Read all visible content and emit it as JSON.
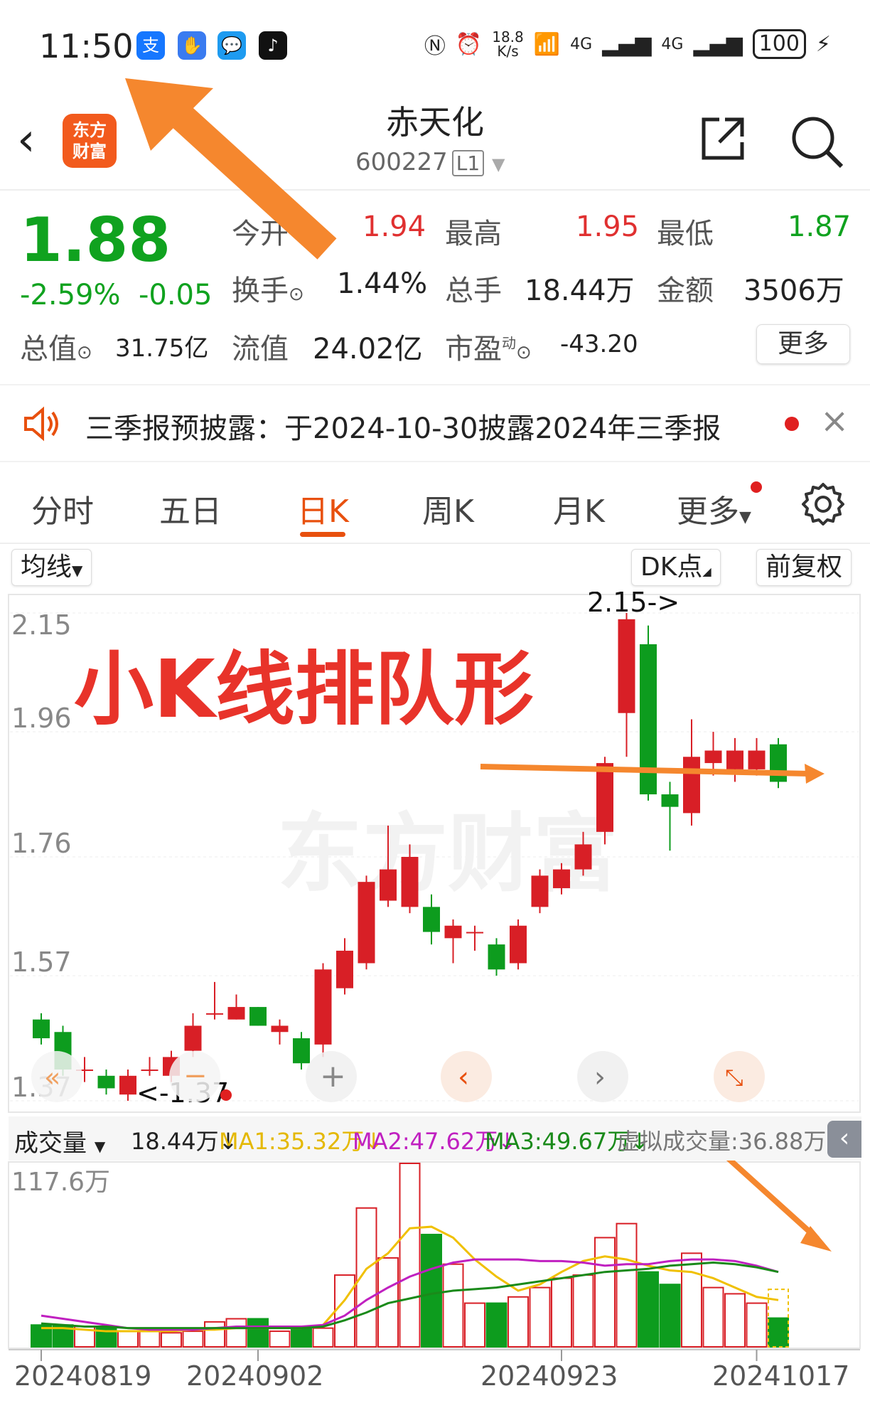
{
  "status_bar": {
    "time": "11:50",
    "net_speed_top": "18.8",
    "net_speed_bottom": "K/s",
    "signal_1": "4G",
    "signal_2": "4G",
    "battery": "100",
    "app_icon_1": "支"
  },
  "header": {
    "logo_line1": "东方",
    "logo_line2": "财富",
    "stock_name": "赤天化",
    "stock_code": "600227",
    "level_badge": "L1"
  },
  "quote": {
    "price": "1.88",
    "change_pct": "-2.59%",
    "change_abs": "-0.05",
    "today_open_label": "今开",
    "today_open": "1.94",
    "high_label": "最高",
    "high": "1.95",
    "low_label": "最低",
    "low": "1.87",
    "turnover_label": "换手",
    "turnover": "1.44%",
    "volume_label": "总手",
    "volume": "18.44万",
    "amount_label": "金额",
    "amount": "3506万",
    "total_value_label": "总值",
    "total_value": "31.75亿",
    "float_value_label": "流值",
    "float_value": "24.02亿",
    "pe_label": "市盈",
    "pe_super": "动",
    "pe": "-43.20",
    "more_label": "更多"
  },
  "notice": {
    "text": "三季报预披露：于2024-10-30披露2024年三季报"
  },
  "tabs": [
    "分时",
    "五日",
    "日K",
    "周K",
    "月K",
    "更多"
  ],
  "active_tab": "日K",
  "chart_toolbar": {
    "ma_label": "均线",
    "dk_label": "DK点",
    "adjust_label": "前复权"
  },
  "annotation": {
    "title": "小K线排队形",
    "watermark": "东方财富"
  },
  "volume_bar": {
    "label": "成交量",
    "value": "18.44万↓",
    "ma1": "MA1:35.32万↓",
    "ma2": "MA2:47.62万↓",
    "ma3": "MA3:49.67万↓",
    "virtual": "虚拟成交量:36.88万"
  },
  "colors": {
    "up": "#d81f26",
    "down": "#0d9c1e",
    "accent": "#e8500e",
    "ma1": "#f0c000",
    "ma2": "#c020c0",
    "ma3": "#1a8a1a",
    "arrow": "#f5872e"
  },
  "chart_data": {
    "type": "candlestick",
    "y_ticks": [
      "2.15",
      "1.96",
      "1.76",
      "1.57",
      "1.37"
    ],
    "ylim": [
      1.37,
      2.15
    ],
    "max_label": "2.15->",
    "min_label": "<-1.37",
    "x_labels": [
      "20240819",
      "20240902",
      "20240923",
      "20241017"
    ],
    "candles": [
      {
        "o": 1.5,
        "c": 1.47,
        "h": 1.51,
        "l": 1.46
      },
      {
        "o": 1.48,
        "c": 1.42,
        "h": 1.49,
        "l": 1.41
      },
      {
        "o": 1.42,
        "c": 1.42,
        "h": 1.44,
        "l": 1.4
      },
      {
        "o": 1.41,
        "c": 1.39,
        "h": 1.42,
        "l": 1.38
      },
      {
        "o": 1.38,
        "c": 1.41,
        "h": 1.42,
        "l": 1.37
      },
      {
        "o": 1.42,
        "c": 1.42,
        "h": 1.44,
        "l": 1.41
      },
      {
        "o": 1.41,
        "c": 1.44,
        "h": 1.45,
        "l": 1.4
      },
      {
        "o": 1.45,
        "c": 1.49,
        "h": 1.51,
        "l": 1.44
      },
      {
        "o": 1.51,
        "c": 1.51,
        "h": 1.56,
        "l": 1.5
      },
      {
        "o": 1.5,
        "c": 1.52,
        "h": 1.54,
        "l": 1.5
      },
      {
        "o": 1.52,
        "c": 1.49,
        "h": 1.52,
        "l": 1.49
      },
      {
        "o": 1.48,
        "c": 1.49,
        "h": 1.5,
        "l": 1.46
      },
      {
        "o": 1.47,
        "c": 1.43,
        "h": 1.48,
        "l": 1.42
      },
      {
        "o": 1.46,
        "c": 1.58,
        "h": 1.59,
        "l": 1.44
      },
      {
        "o": 1.55,
        "c": 1.61,
        "h": 1.63,
        "l": 1.54
      },
      {
        "o": 1.59,
        "c": 1.72,
        "h": 1.73,
        "l": 1.58
      },
      {
        "o": 1.69,
        "c": 1.74,
        "h": 1.81,
        "l": 1.68
      },
      {
        "o": 1.68,
        "c": 1.76,
        "h": 1.78,
        "l": 1.67
      },
      {
        "o": 1.68,
        "c": 1.64,
        "h": 1.7,
        "l": 1.62
      },
      {
        "o": 1.63,
        "c": 1.65,
        "h": 1.66,
        "l": 1.59
      },
      {
        "o": 1.64,
        "c": 1.64,
        "h": 1.65,
        "l": 1.61
      },
      {
        "o": 1.62,
        "c": 1.58,
        "h": 1.63,
        "l": 1.57
      },
      {
        "o": 1.59,
        "c": 1.65,
        "h": 1.66,
        "l": 1.58
      },
      {
        "o": 1.68,
        "c": 1.73,
        "h": 1.74,
        "l": 1.67
      },
      {
        "o": 1.71,
        "c": 1.74,
        "h": 1.75,
        "l": 1.7
      },
      {
        "o": 1.74,
        "c": 1.78,
        "h": 1.8,
        "l": 1.73
      },
      {
        "o": 1.8,
        "c": 1.91,
        "h": 1.92,
        "l": 1.78
      },
      {
        "o": 1.99,
        "c": 2.14,
        "h": 2.15,
        "l": 1.92
      },
      {
        "o": 2.1,
        "c": 1.86,
        "h": 2.13,
        "l": 1.85
      },
      {
        "o": 1.86,
        "c": 1.84,
        "h": 1.88,
        "l": 1.77
      },
      {
        "o": 1.83,
        "c": 1.92,
        "h": 1.98,
        "l": 1.81
      },
      {
        "o": 1.91,
        "c": 1.93,
        "h": 1.96,
        "l": 1.89
      },
      {
        "o": 1.9,
        "c": 1.93,
        "h": 1.95,
        "l": 1.88
      },
      {
        "o": 1.9,
        "c": 1.93,
        "h": 1.95,
        "l": 1.89
      },
      {
        "o": 1.94,
        "c": 1.88,
        "h": 1.95,
        "l": 1.87
      }
    ],
    "volume_max_label": "117.6万",
    "volume_ylim": [
      0,
      117.6
    ],
    "volumes": [
      14,
      14,
      13,
      12,
      10,
      10,
      9,
      10,
      16,
      18,
      18,
      10,
      12,
      12,
      46,
      89,
      57,
      117.6,
      72,
      53,
      28,
      28,
      32,
      38,
      44,
      46,
      70,
      79,
      48,
      40,
      60,
      38,
      34,
      28,
      18.44
    ],
    "ma1": [
      12,
      12,
      11,
      10,
      10,
      10,
      10,
      11,
      11,
      12,
      12,
      12,
      12,
      14,
      30,
      50,
      60,
      76,
      77,
      70,
      56,
      45,
      36,
      40,
      48,
      55,
      58,
      56,
      52,
      49,
      48,
      44,
      38,
      32,
      30
    ],
    "ma2": [
      20,
      18,
      16,
      14,
      12,
      11,
      11,
      11,
      12,
      13,
      13,
      13,
      13,
      14,
      20,
      30,
      38,
      45,
      50,
      54,
      56,
      56,
      56,
      55,
      55,
      54,
      52,
      53,
      53,
      55,
      56,
      56,
      55,
      52,
      48
    ],
    "ma3": [
      15,
      14,
      13,
      13,
      12,
      12,
      12,
      12,
      12,
      12,
      12,
      12,
      12,
      13,
      17,
      22,
      28,
      31,
      34,
      36,
      37,
      38,
      40,
      42,
      44,
      46,
      48,
      49,
      50,
      52,
      53,
      54,
      53,
      51,
      48
    ]
  }
}
